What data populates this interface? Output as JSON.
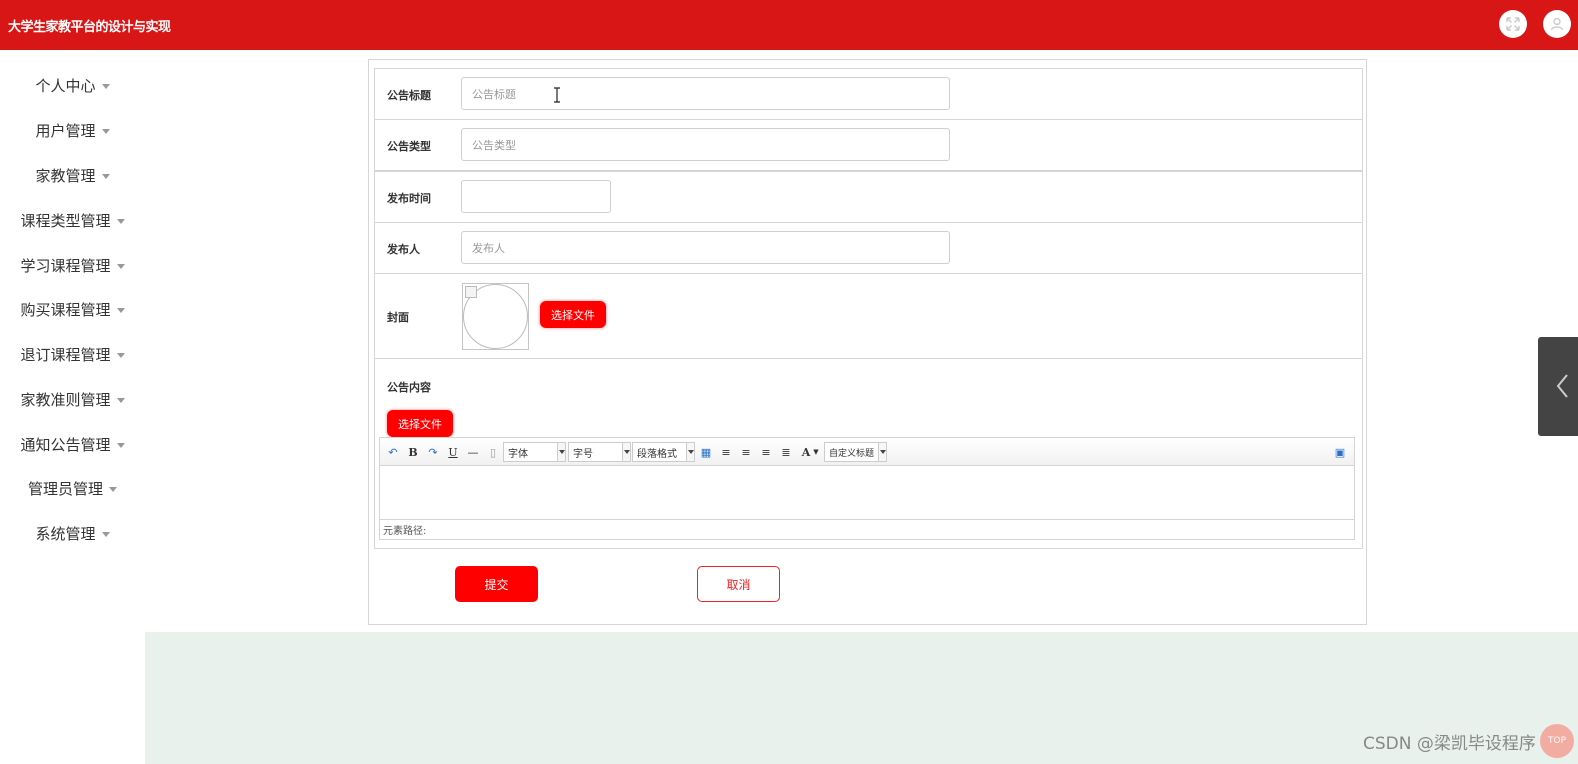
{
  "header": {
    "app_title": "大学生家教平台的设计与实现",
    "icons": [
      "fullscreen-icon",
      "user-icon"
    ]
  },
  "sidebar": {
    "items": [
      {
        "label": "个人中心"
      },
      {
        "label": "用户管理"
      },
      {
        "label": "家教管理"
      },
      {
        "label": "课程类型管理"
      },
      {
        "label": "学习课程管理"
      },
      {
        "label": "购买课程管理"
      },
      {
        "label": "退订课程管理"
      },
      {
        "label": "家教准则管理"
      },
      {
        "label": "通知公告管理"
      },
      {
        "label": "管理员管理"
      },
      {
        "label": "系统管理"
      }
    ]
  },
  "form": {
    "title_label": "公告标题",
    "title_placeholder": "公告标题",
    "type_label": "公告类型",
    "type_placeholder": "公告类型",
    "time_label": "发布时间",
    "time_value": "",
    "publisher_label": "发布人",
    "publisher_placeholder": "发布人",
    "cover_label": "封面",
    "cover_button": "选择文件",
    "content_label": "公告内容",
    "content_button": "选择文件",
    "submit_label": "提交",
    "cancel_label": "取消"
  },
  "editor": {
    "font_select": "字体",
    "size_select": "字号",
    "para_select": "段落格式",
    "custom_title_select": "自定义标题",
    "bold": "B",
    "underline": "U",
    "font_color": "A",
    "element_path": "元素路径:"
  },
  "watermark": "CSDN @梁凯毕设程序",
  "float_badge": "TOP",
  "colors": {
    "brand_red": "#d91616",
    "button_red": "#ff0000",
    "footer_band": "#e8f1ec"
  }
}
